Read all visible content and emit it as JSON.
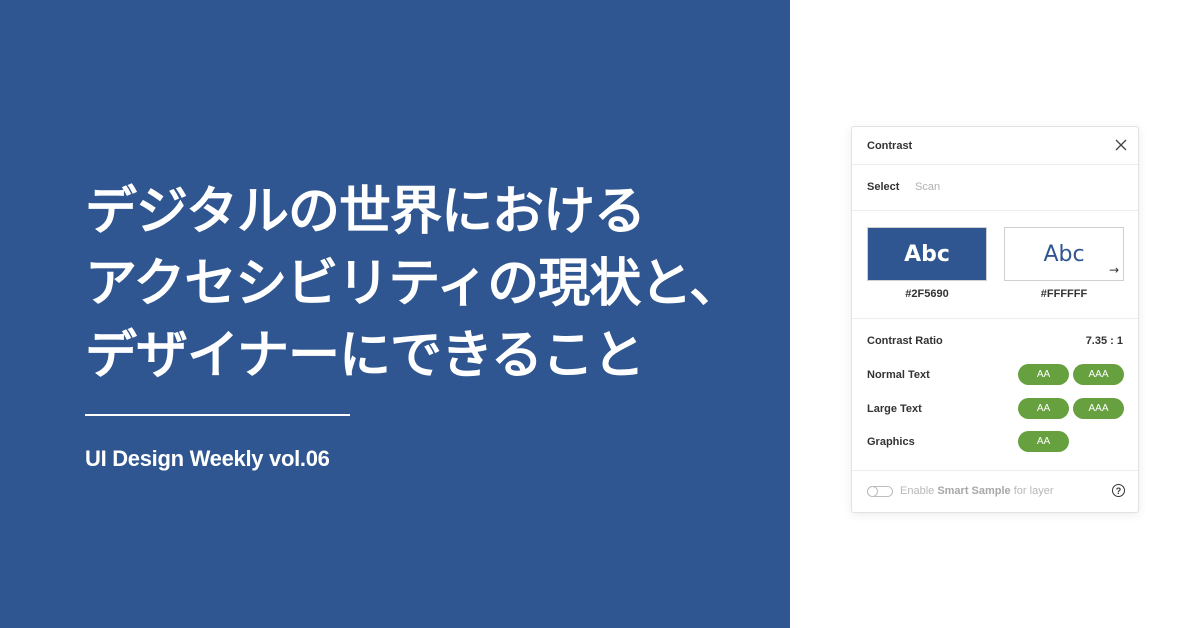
{
  "banner": {
    "background_color": "#2F5690",
    "headline_lines": [
      "デジタルの世界における",
      "アクセシビリティの現状と、",
      "デザイナーにできること"
    ],
    "subtitle": "UI Design Weekly vol.06"
  },
  "panel": {
    "title": "Contrast",
    "close_icon": "close-icon",
    "tabs": [
      {
        "label": "Select",
        "active": true
      },
      {
        "label": "Scan",
        "active": false
      }
    ],
    "swatches": {
      "sample_text": "Abc",
      "background_hex": "#2F5690",
      "foreground_hex": "#FFFFFF",
      "swap_icon": "→"
    },
    "contrast_ratio_label": "Contrast Ratio",
    "contrast_ratio_value": "7.35 : 1",
    "results": [
      {
        "label": "Normal Text",
        "badges": [
          "AA",
          "AAA"
        ]
      },
      {
        "label": "Large Text",
        "badges": [
          "AA",
          "AAA"
        ]
      },
      {
        "label": "Graphics",
        "badges": [
          "AA"
        ]
      }
    ],
    "pass_color": "#66A03F",
    "footer": {
      "prefix": "Enable ",
      "bold": "Smart Sample",
      "suffix": " for layer",
      "toggle_on": false,
      "help_glyph": "?"
    }
  }
}
